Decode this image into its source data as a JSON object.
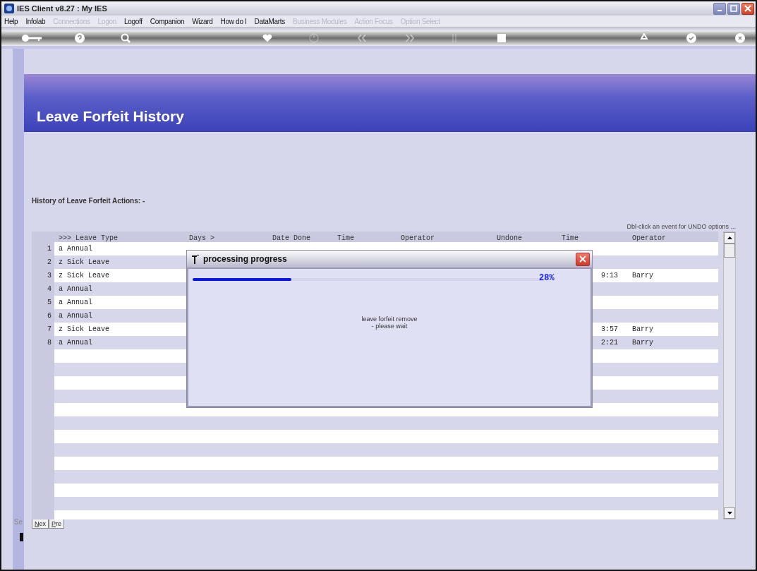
{
  "window": {
    "title": "IES Client v8.27 : My IES"
  },
  "menu": [
    {
      "label": "Help",
      "disabled": false
    },
    {
      "label": "Infolab",
      "disabled": false
    },
    {
      "label": "Connections",
      "disabled": true
    },
    {
      "label": "Logon",
      "disabled": true
    },
    {
      "label": "Logoff",
      "disabled": false
    },
    {
      "label": "Companion",
      "disabled": false
    },
    {
      "label": "Wizard",
      "disabled": false
    },
    {
      "label": "How do I",
      "disabled": false
    },
    {
      "label": "DataMarts",
      "disabled": false
    },
    {
      "label": "Business Modules",
      "disabled": true
    },
    {
      "label": "Action Focus",
      "disabled": true
    },
    {
      "label": "Option Select",
      "disabled": true
    }
  ],
  "page": {
    "title": "Leave Forfeit History",
    "section_label": "History of Leave Forfeit Actions: -",
    "hint": "Dbl-click an event for UNDO options ..."
  },
  "table": {
    "columns": [
      ">>> Leave Type",
      "Days >",
      "Date Done",
      "Time",
      "Operator",
      "Undone",
      "Time",
      "Operator"
    ],
    "rows": [
      {
        "number": "1",
        "leave_type": "a Annual"
      },
      {
        "number": "2",
        "leave_type": "z Sick Leave"
      },
      {
        "number": "3",
        "leave_type": "z Sick Leave",
        "undone_time": "9:13",
        "undone_operator": "Barry"
      },
      {
        "number": "4",
        "leave_type": "a Annual"
      },
      {
        "number": "5",
        "leave_type": "a Annual"
      },
      {
        "number": "6",
        "leave_type": "a Annual"
      },
      {
        "number": "7",
        "leave_type": "z Sick Leave",
        "undone_time": "3:57",
        "undone_operator": "Barry"
      },
      {
        "number": "8",
        "leave_type": "a Annual",
        "undone_time": "2:21",
        "undone_operator": "Barry"
      }
    ]
  },
  "side_label": "Se",
  "tab_buttons": [
    {
      "label": "Nex"
    },
    {
      "label": "Pre"
    }
  ],
  "dialog": {
    "title": "processing progress",
    "level": 0.28,
    "percent": "28%",
    "message": [
      "leave forfeit remove",
      "- please wait"
    ]
  }
}
